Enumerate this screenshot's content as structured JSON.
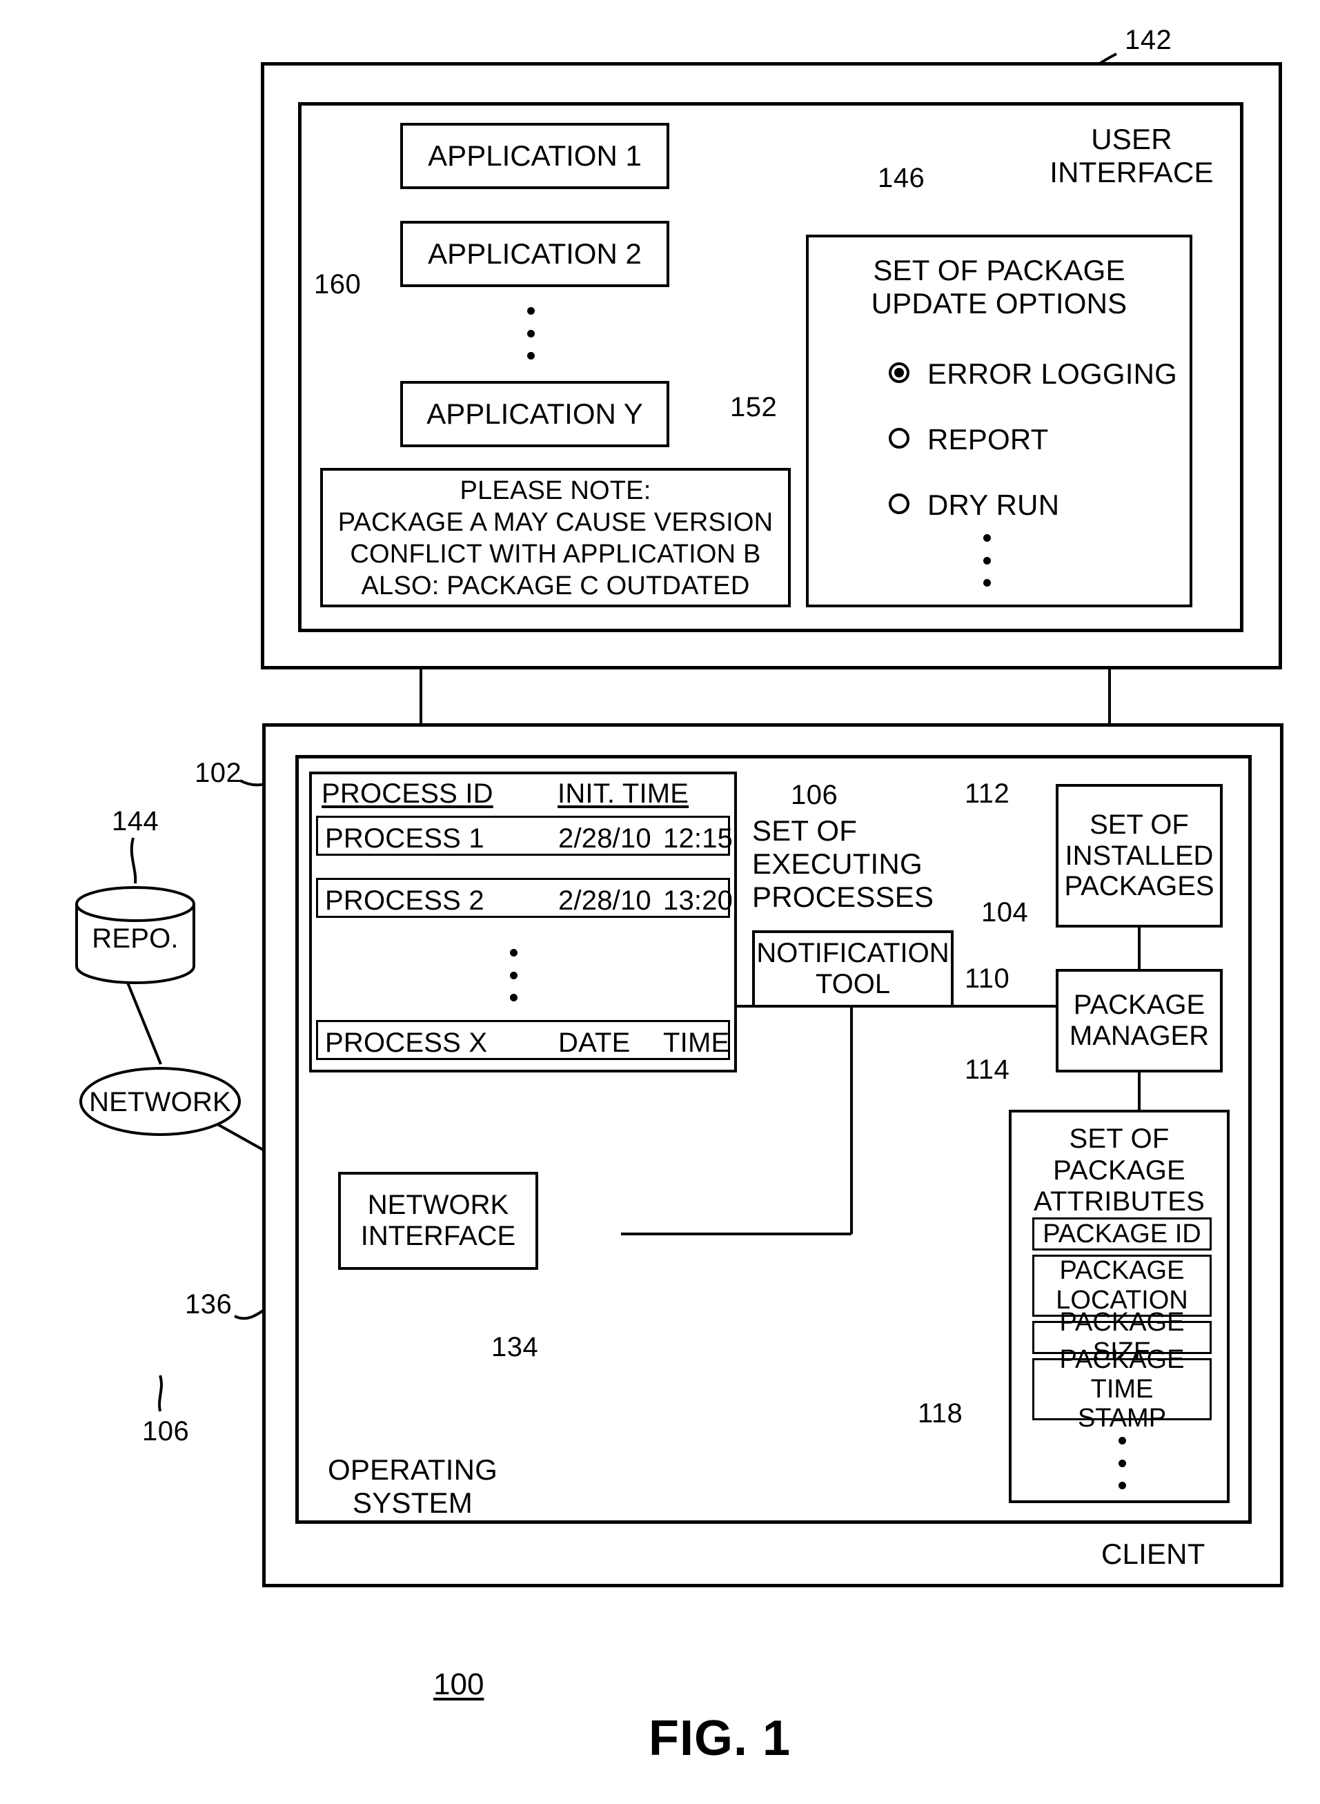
{
  "figure": {
    "caption": "FIG. 1",
    "system_number": "100"
  },
  "user_interface_panel": {
    "outer_ref": "142",
    "title": "USER\nINTERFACE",
    "applications": {
      "brace_ref": "160",
      "items": [
        {
          "label": "APPLICATION 1"
        },
        {
          "label": "APPLICATION 2"
        },
        {
          "label": "APPLICATION Y"
        }
      ],
      "ellipsis": "vertical-dots"
    },
    "note": {
      "ref": "152",
      "lines": [
        "PLEASE NOTE:",
        "PACKAGE A MAY CAUSE VERSION",
        "CONFLICT WITH APPLICATION B",
        "ALSO: PACKAGE C OUTDATED"
      ]
    },
    "update_options": {
      "ref": "146",
      "title": "SET OF PACKAGE\nUPDATE OPTIONS",
      "options": [
        {
          "label": "ERROR LOGGING",
          "selected": true
        },
        {
          "label": "REPORT",
          "selected": false
        },
        {
          "label": "DRY RUN",
          "selected": false
        }
      ],
      "ellipsis": "vertical-dots",
      "cursor": "mouse-pointer"
    }
  },
  "client_panel": {
    "client_label": "CLIENT",
    "operating_system_label": "OPERATING\nSYSTEM",
    "os_ref": "102",
    "client_ref": "136",
    "executing_processes": {
      "ref": "106",
      "label": "SET OF\nEXECUTING\nPROCESSES",
      "columns": [
        "PROCESS ID",
        "INIT. TIME"
      ],
      "rows": [
        {
          "id": "PROCESS 1",
          "date": "2/28/10",
          "time": "12:15"
        },
        {
          "id": "PROCESS 2",
          "date": "2/28/10",
          "time": "13:20"
        },
        {
          "id": "PROCESS X",
          "date": "DATE",
          "time": "TIME"
        }
      ],
      "ellipsis": "vertical-dots"
    },
    "notification_tool": {
      "ref": "104",
      "label": "NOTIFICATION\nTOOL"
    },
    "installed_packages": {
      "ref": "112",
      "label": "SET OF\nINSTALLED\nPACKAGES"
    },
    "package_manager": {
      "ref": "110",
      "label": "PACKAGE\nMANAGER"
    },
    "package_attributes": {
      "ref": "114",
      "title": "SET OF\nPACKAGE\nATTRIBUTES",
      "timestamp_ref": "118",
      "items": [
        {
          "label": "PACKAGE ID"
        },
        {
          "label": "PACKAGE\nLOCATION"
        },
        {
          "label": "PACKAGE SIZE"
        },
        {
          "label": "PACKAGE TIME\nSTAMP"
        }
      ],
      "ellipsis": "vertical-dots"
    },
    "network_interface": {
      "ref": "134",
      "label": "NETWORK\nINTERFACE"
    }
  },
  "external": {
    "repository": {
      "ref": "144",
      "label": "REPO."
    },
    "network": {
      "ref": "106",
      "label": "NETWORK"
    }
  }
}
